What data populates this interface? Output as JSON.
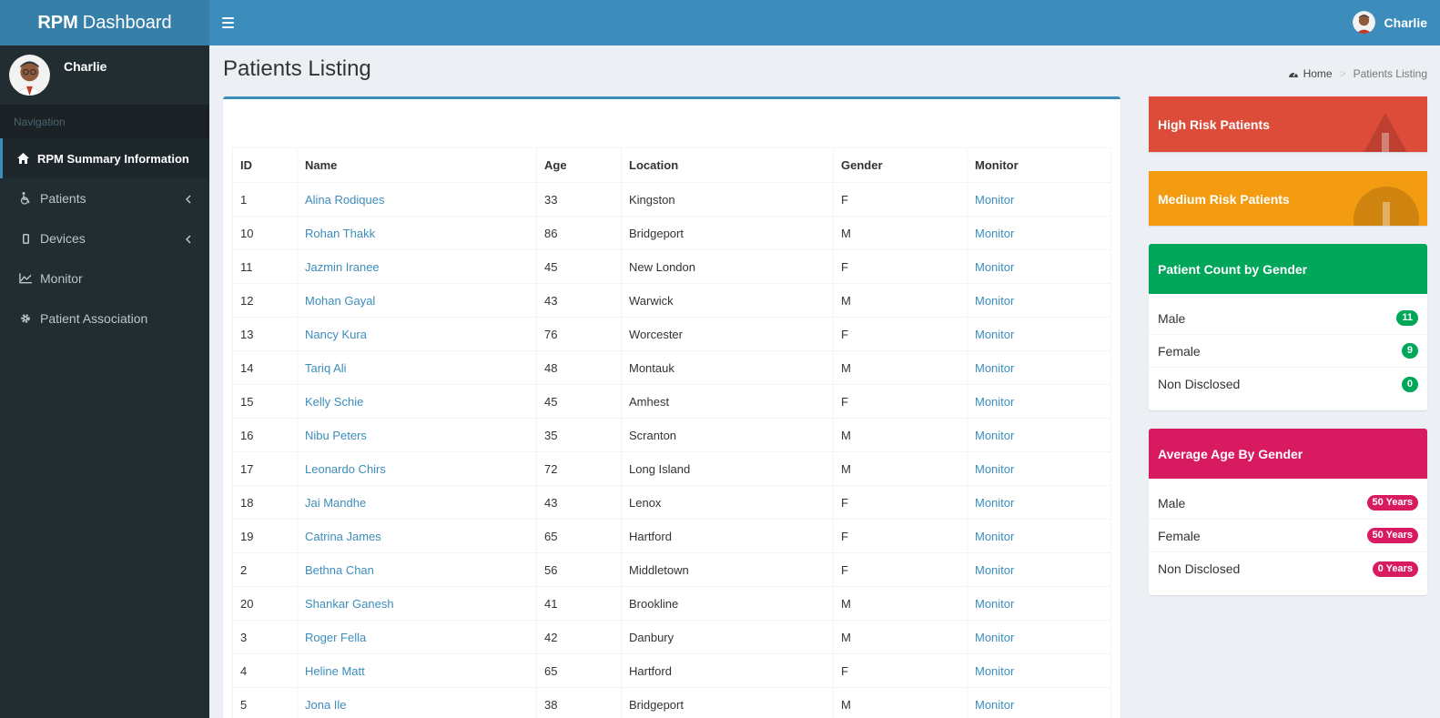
{
  "brand": {
    "bold": "RPM",
    "rest": "Dashboard"
  },
  "user": {
    "name": "Charlie"
  },
  "sidebar": {
    "header": "Navigation",
    "items": [
      {
        "label": "RPM Summary Information",
        "icon": "home-icon",
        "active": true
      },
      {
        "label": "Patients",
        "icon": "wheelchair-icon"
      },
      {
        "label": "Devices",
        "icon": "mobile-icon"
      },
      {
        "label": "Monitor",
        "icon": "line-chart-icon"
      },
      {
        "label": "Patient Association",
        "icon": "gear-icon"
      }
    ]
  },
  "page": {
    "title": "Patients Listing"
  },
  "breadcrumb": {
    "home": "Home",
    "sep": ">",
    "current": "Patients Listing"
  },
  "table": {
    "headers": [
      "ID",
      "Name",
      "Age",
      "Location",
      "Gender",
      "Monitor"
    ],
    "rows": [
      {
        "id": "1",
        "name": "Alina Rodiques",
        "age": "33",
        "location": "Kingston",
        "gender": "F",
        "monitor": "Monitor"
      },
      {
        "id": "10",
        "name": "Rohan Thakk",
        "age": "86",
        "location": "Bridgeport",
        "gender": "M",
        "monitor": "Monitor"
      },
      {
        "id": "11",
        "name": "Jazmin Iranee",
        "age": "45",
        "location": "New London",
        "gender": "F",
        "monitor": "Monitor"
      },
      {
        "id": "12",
        "name": "Mohan Gayal",
        "age": "43",
        "location": "Warwick",
        "gender": "M",
        "monitor": "Monitor"
      },
      {
        "id": "13",
        "name": "Nancy Kura",
        "age": "76",
        "location": "Worcester",
        "gender": "F",
        "monitor": "Monitor"
      },
      {
        "id": "14",
        "name": "Tariq Ali",
        "age": "48",
        "location": "Montauk",
        "gender": "M",
        "monitor": "Monitor"
      },
      {
        "id": "15",
        "name": "Kelly Schie",
        "age": "45",
        "location": "Amhest",
        "gender": "F",
        "monitor": "Monitor"
      },
      {
        "id": "16",
        "name": "Nibu Peters",
        "age": "35",
        "location": "Scranton",
        "gender": "M",
        "monitor": "Monitor"
      },
      {
        "id": "17",
        "name": "Leonardo Chirs",
        "age": "72",
        "location": "Long Island",
        "gender": "M",
        "monitor": "Monitor"
      },
      {
        "id": "18",
        "name": "Jai Mandhe",
        "age": "43",
        "location": "Lenox",
        "gender": "F",
        "monitor": "Monitor"
      },
      {
        "id": "19",
        "name": "Catrina James",
        "age": "65",
        "location": "Hartford",
        "gender": "F",
        "monitor": "Monitor"
      },
      {
        "id": "2",
        "name": "Bethna Chan",
        "age": "56",
        "location": "Middletown",
        "gender": "F",
        "monitor": "Monitor"
      },
      {
        "id": "20",
        "name": "Shankar Ganesh",
        "age": "41",
        "location": "Brookline",
        "gender": "M",
        "monitor": "Monitor"
      },
      {
        "id": "3",
        "name": "Roger Fella",
        "age": "42",
        "location": "Danbury",
        "gender": "M",
        "monitor": "Monitor"
      },
      {
        "id": "4",
        "name": "Heline Matt",
        "age": "65",
        "location": "Hartford",
        "gender": "F",
        "monitor": "Monitor"
      },
      {
        "id": "5",
        "name": "Jona Ile",
        "age": "38",
        "location": "Bridgeport",
        "gender": "M",
        "monitor": "Monitor"
      }
    ]
  },
  "risk": {
    "high": {
      "label": "High Risk Patients",
      "color": "#dd4b39",
      "icon": "warning-icon"
    },
    "medium": {
      "label": "Medium Risk Patients",
      "color": "#f39c12",
      "icon": "exclamation-circle-icon"
    }
  },
  "gender_count": {
    "title": "Patient Count by Gender",
    "color": "#00a65a",
    "rows": [
      {
        "label": "Male",
        "value": "11"
      },
      {
        "label": "Female",
        "value": "9"
      },
      {
        "label": "Non Disclosed",
        "value": "0"
      }
    ]
  },
  "avg_age": {
    "title": "Average Age By Gender",
    "color": "#d81b60",
    "rows": [
      {
        "label": "Male",
        "value": "50 Years"
      },
      {
        "label": "Female",
        "value": "50 Years"
      },
      {
        "label": "Non Disclosed",
        "value": "0 Years"
      }
    ]
  }
}
